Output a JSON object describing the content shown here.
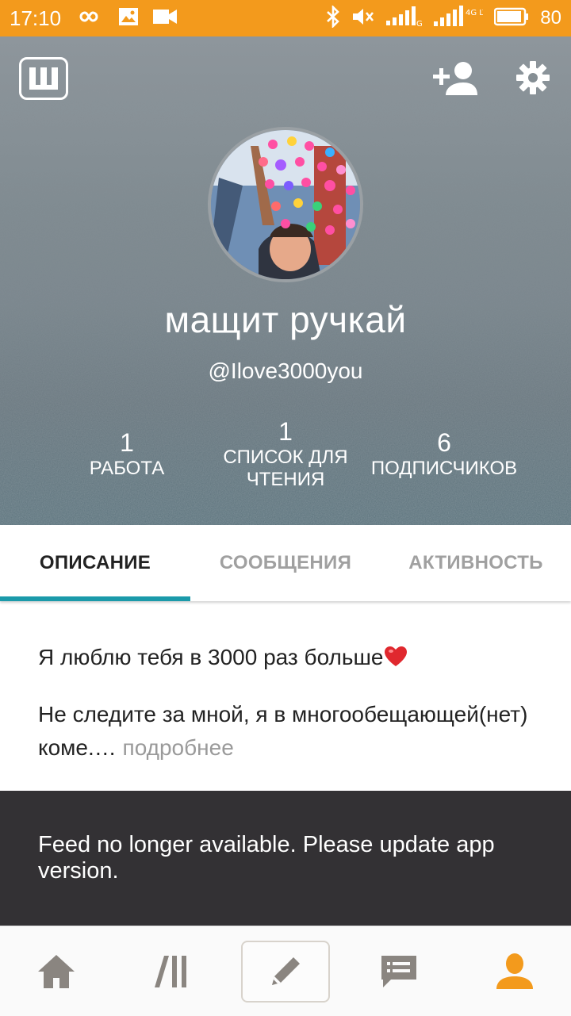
{
  "status_bar": {
    "time": "17:10",
    "battery": "80",
    "network_labels": [
      "G",
      "4G LTE"
    ],
    "icons": [
      "infinity-icon",
      "gallery-icon",
      "video-icon",
      "bluetooth-icon",
      "mute-icon",
      "signal-icon",
      "signal-icon-2",
      "battery-icon"
    ]
  },
  "header": {
    "logo_icon": "wattpad-logo",
    "follow_icon": "add-person-icon",
    "settings_icon": "gear-icon"
  },
  "profile": {
    "name": "мащит ручкай",
    "handle": "@Ilove3000you",
    "stats": {
      "works": {
        "value": "1",
        "label": "РАБОТА"
      },
      "reading_lists": {
        "value": "1",
        "label_line1": "СПИСОК ДЛЯ",
        "label_line2": "ЧТЕНИЯ"
      },
      "followers": {
        "value": "6",
        "label": "ПОДПИСЧИКОВ"
      }
    }
  },
  "tabs": [
    {
      "label": "ОПИСАНИЕ",
      "active": true
    },
    {
      "label": "СООБЩЕНИЯ",
      "active": false
    },
    {
      "label": "АКТИВНОСТЬ",
      "active": false
    }
  ],
  "description": {
    "line1": "Я люблю тебя в 3000 раз больше",
    "line2": "Не следите за мной, я в многообещающей(нет) коме.…",
    "more": " подробнее"
  },
  "snackbar": {
    "message": "Feed no longer available. Please update app version."
  },
  "bottom_nav": {
    "items": [
      "home-icon",
      "library-icon",
      "write-icon",
      "messages-icon",
      "profile-icon"
    ],
    "active": "profile-icon"
  },
  "colors": {
    "status_bar": "#f39a1c",
    "tab_indicator": "#1b9aaa",
    "active_nav": "#f39a1c",
    "inactive_nav": "#8a8580",
    "snackbar": "#333134"
  }
}
